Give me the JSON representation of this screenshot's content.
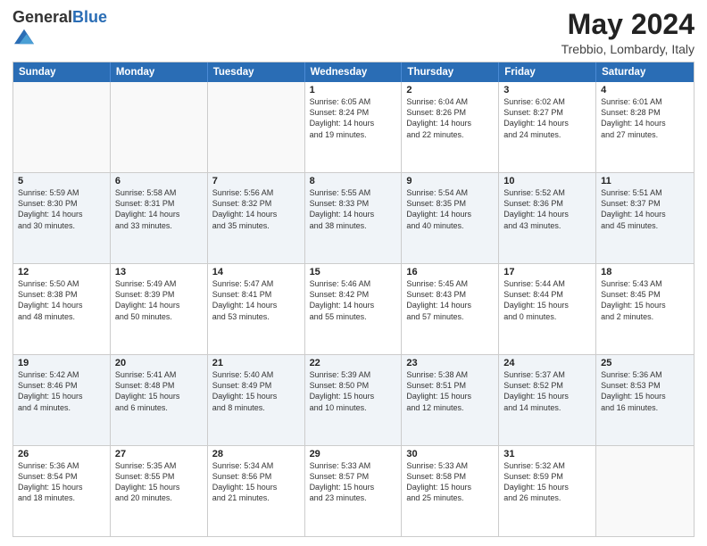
{
  "header": {
    "logo_general": "General",
    "logo_blue": "Blue",
    "month_year": "May 2024",
    "location": "Trebbio, Lombardy, Italy"
  },
  "days_of_week": [
    "Sunday",
    "Monday",
    "Tuesday",
    "Wednesday",
    "Thursday",
    "Friday",
    "Saturday"
  ],
  "weeks": [
    [
      {
        "day": "",
        "text": ""
      },
      {
        "day": "",
        "text": ""
      },
      {
        "day": "",
        "text": ""
      },
      {
        "day": "1",
        "text": "Sunrise: 6:05 AM\nSunset: 8:24 PM\nDaylight: 14 hours\nand 19 minutes."
      },
      {
        "day": "2",
        "text": "Sunrise: 6:04 AM\nSunset: 8:26 PM\nDaylight: 14 hours\nand 22 minutes."
      },
      {
        "day": "3",
        "text": "Sunrise: 6:02 AM\nSunset: 8:27 PM\nDaylight: 14 hours\nand 24 minutes."
      },
      {
        "day": "4",
        "text": "Sunrise: 6:01 AM\nSunset: 8:28 PM\nDaylight: 14 hours\nand 27 minutes."
      }
    ],
    [
      {
        "day": "5",
        "text": "Sunrise: 5:59 AM\nSunset: 8:30 PM\nDaylight: 14 hours\nand 30 minutes."
      },
      {
        "day": "6",
        "text": "Sunrise: 5:58 AM\nSunset: 8:31 PM\nDaylight: 14 hours\nand 33 minutes."
      },
      {
        "day": "7",
        "text": "Sunrise: 5:56 AM\nSunset: 8:32 PM\nDaylight: 14 hours\nand 35 minutes."
      },
      {
        "day": "8",
        "text": "Sunrise: 5:55 AM\nSunset: 8:33 PM\nDaylight: 14 hours\nand 38 minutes."
      },
      {
        "day": "9",
        "text": "Sunrise: 5:54 AM\nSunset: 8:35 PM\nDaylight: 14 hours\nand 40 minutes."
      },
      {
        "day": "10",
        "text": "Sunrise: 5:52 AM\nSunset: 8:36 PM\nDaylight: 14 hours\nand 43 minutes."
      },
      {
        "day": "11",
        "text": "Sunrise: 5:51 AM\nSunset: 8:37 PM\nDaylight: 14 hours\nand 45 minutes."
      }
    ],
    [
      {
        "day": "12",
        "text": "Sunrise: 5:50 AM\nSunset: 8:38 PM\nDaylight: 14 hours\nand 48 minutes."
      },
      {
        "day": "13",
        "text": "Sunrise: 5:49 AM\nSunset: 8:39 PM\nDaylight: 14 hours\nand 50 minutes."
      },
      {
        "day": "14",
        "text": "Sunrise: 5:47 AM\nSunset: 8:41 PM\nDaylight: 14 hours\nand 53 minutes."
      },
      {
        "day": "15",
        "text": "Sunrise: 5:46 AM\nSunset: 8:42 PM\nDaylight: 14 hours\nand 55 minutes."
      },
      {
        "day": "16",
        "text": "Sunrise: 5:45 AM\nSunset: 8:43 PM\nDaylight: 14 hours\nand 57 minutes."
      },
      {
        "day": "17",
        "text": "Sunrise: 5:44 AM\nSunset: 8:44 PM\nDaylight: 15 hours\nand 0 minutes."
      },
      {
        "day": "18",
        "text": "Sunrise: 5:43 AM\nSunset: 8:45 PM\nDaylight: 15 hours\nand 2 minutes."
      }
    ],
    [
      {
        "day": "19",
        "text": "Sunrise: 5:42 AM\nSunset: 8:46 PM\nDaylight: 15 hours\nand 4 minutes."
      },
      {
        "day": "20",
        "text": "Sunrise: 5:41 AM\nSunset: 8:48 PM\nDaylight: 15 hours\nand 6 minutes."
      },
      {
        "day": "21",
        "text": "Sunrise: 5:40 AM\nSunset: 8:49 PM\nDaylight: 15 hours\nand 8 minutes."
      },
      {
        "day": "22",
        "text": "Sunrise: 5:39 AM\nSunset: 8:50 PM\nDaylight: 15 hours\nand 10 minutes."
      },
      {
        "day": "23",
        "text": "Sunrise: 5:38 AM\nSunset: 8:51 PM\nDaylight: 15 hours\nand 12 minutes."
      },
      {
        "day": "24",
        "text": "Sunrise: 5:37 AM\nSunset: 8:52 PM\nDaylight: 15 hours\nand 14 minutes."
      },
      {
        "day": "25",
        "text": "Sunrise: 5:36 AM\nSunset: 8:53 PM\nDaylight: 15 hours\nand 16 minutes."
      }
    ],
    [
      {
        "day": "26",
        "text": "Sunrise: 5:36 AM\nSunset: 8:54 PM\nDaylight: 15 hours\nand 18 minutes."
      },
      {
        "day": "27",
        "text": "Sunrise: 5:35 AM\nSunset: 8:55 PM\nDaylight: 15 hours\nand 20 minutes."
      },
      {
        "day": "28",
        "text": "Sunrise: 5:34 AM\nSunset: 8:56 PM\nDaylight: 15 hours\nand 21 minutes."
      },
      {
        "day": "29",
        "text": "Sunrise: 5:33 AM\nSunset: 8:57 PM\nDaylight: 15 hours\nand 23 minutes."
      },
      {
        "day": "30",
        "text": "Sunrise: 5:33 AM\nSunset: 8:58 PM\nDaylight: 15 hours\nand 25 minutes."
      },
      {
        "day": "31",
        "text": "Sunrise: 5:32 AM\nSunset: 8:59 PM\nDaylight: 15 hours\nand 26 minutes."
      },
      {
        "day": "",
        "text": ""
      }
    ]
  ]
}
